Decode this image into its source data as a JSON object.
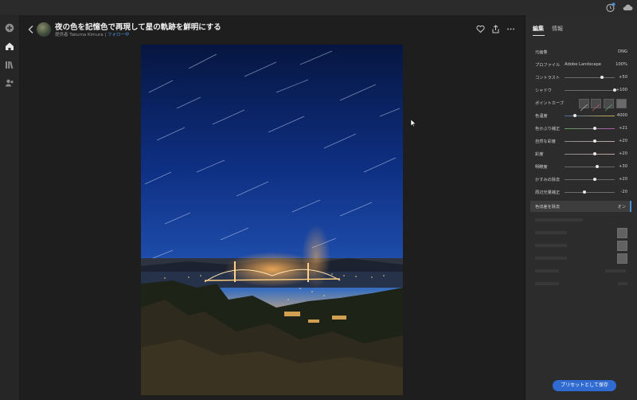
{
  "header": {
    "title": "夜の色を記憶色で再現して星の軌跡を鮮明にする",
    "byline_prefix": "提供者 Takuma Kimura",
    "separator": "|",
    "follow_label": "フォロー中"
  },
  "panel": {
    "tabs": [
      {
        "label": "編集",
        "active": true
      },
      {
        "label": "情報",
        "active": false
      }
    ],
    "original": {
      "label": "元画像",
      "value": "DNG"
    },
    "profile": {
      "label": "プロファイル",
      "name": "Adobe Landscape",
      "amount": "100%"
    },
    "sliders": [
      {
        "label": "コントラスト",
        "value": "+50",
        "fraction": 0.75
      },
      {
        "label": "シャドウ",
        "value": "+100",
        "fraction": 1.0
      }
    ],
    "point_curve": {
      "label": "ポイントカーブ"
    },
    "color_sliders": [
      {
        "label": "色温度",
        "value": "4000",
        "fraction": 0.2,
        "style": "temp"
      },
      {
        "label": "色かぶり補正",
        "value": "+21",
        "fraction": 0.6,
        "style": "tint"
      },
      {
        "label": "自然な彩度",
        "value": "+20",
        "fraction": 0.6,
        "style": "sat"
      },
      {
        "label": "彩度",
        "value": "+20",
        "fraction": 0.6,
        "style": "sat"
      },
      {
        "label": "明瞭度",
        "value": "+30",
        "fraction": 0.65,
        "style": "plain"
      },
      {
        "label": "かすみの除去",
        "value": "+20",
        "fraction": 0.6,
        "style": "plain"
      },
      {
        "label": "周辺光量補正",
        "value": "-20",
        "fraction": 0.4,
        "style": "plain"
      }
    ],
    "chromatic": {
      "label": "色収差を除去",
      "value": "オン"
    },
    "save_button": "プリセットとして保存"
  }
}
